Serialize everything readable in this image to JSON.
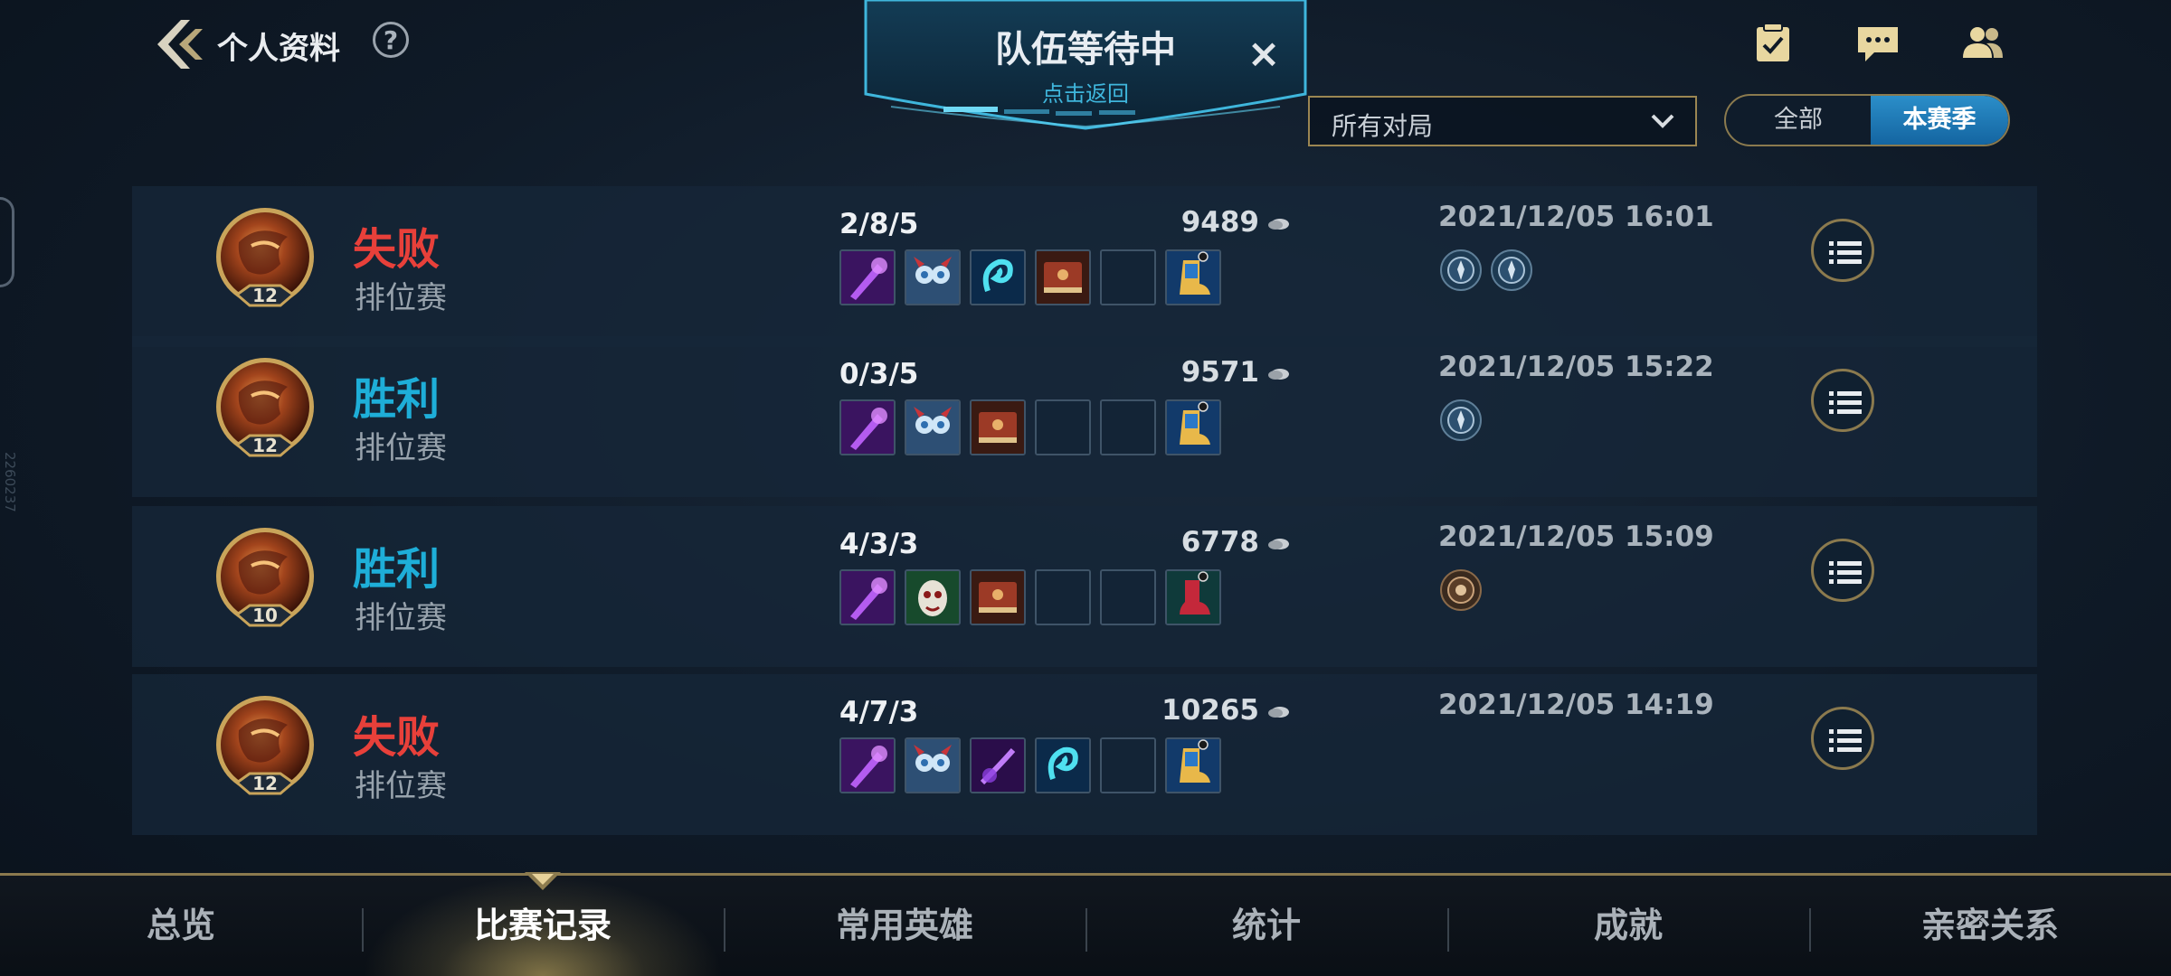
{
  "header": {
    "title": "个人资料",
    "help": "?"
  },
  "banner": {
    "title": "队伍等待中",
    "subtitle": "点击返回",
    "close": "×"
  },
  "filter": {
    "selected": "所有对局"
  },
  "segment": {
    "options": [
      "全部",
      "本赛季"
    ],
    "active": "本赛季"
  },
  "side_number": "2260237",
  "matches": [
    {
      "result": "失败",
      "outcome": "lose",
      "mode": "排位赛",
      "level": "12",
      "kda": "2/8/5",
      "gold": "9489",
      "date": "2021/12/05 16:01",
      "items": [
        "purple-staff",
        "owl-mask",
        "blue-spirit",
        "red-book",
        "empty",
        "gold-boots"
      ],
      "badges": 2
    },
    {
      "result": "胜利",
      "outcome": "win",
      "mode": "排位赛",
      "level": "12",
      "kda": "0/3/5",
      "gold": "9571",
      "date": "2021/12/05 15:22",
      "items": [
        "purple-staff",
        "owl-mask",
        "red-book",
        "empty",
        "empty",
        "gold-boots"
      ],
      "badges": 1
    },
    {
      "result": "胜利",
      "outcome": "win",
      "mode": "排位赛",
      "level": "10",
      "kda": "4/3/3",
      "gold": "6778",
      "date": "2021/12/05 15:09",
      "items": [
        "purple-staff",
        "green-mask",
        "red-book",
        "empty",
        "empty",
        "red-boots"
      ],
      "badges": 1
    },
    {
      "result": "失败",
      "outcome": "lose",
      "mode": "排位赛",
      "level": "12",
      "kda": "4/7/3",
      "gold": "10265",
      "date": "2021/12/05 14:19",
      "items": [
        "purple-staff",
        "owl-mask",
        "purple-wand",
        "blue-spirit",
        "empty",
        "gold-boots"
      ],
      "badges": 0
    }
  ],
  "tabs": [
    "总览",
    "比赛记录",
    "常用英雄",
    "统计",
    "成就",
    "亲密关系"
  ],
  "active_tab": "比赛记录",
  "colors": {
    "lose": "#e8403a",
    "win": "#1eaed8",
    "accent": "#8b7a4e",
    "active_segment": "#1b78b4"
  }
}
